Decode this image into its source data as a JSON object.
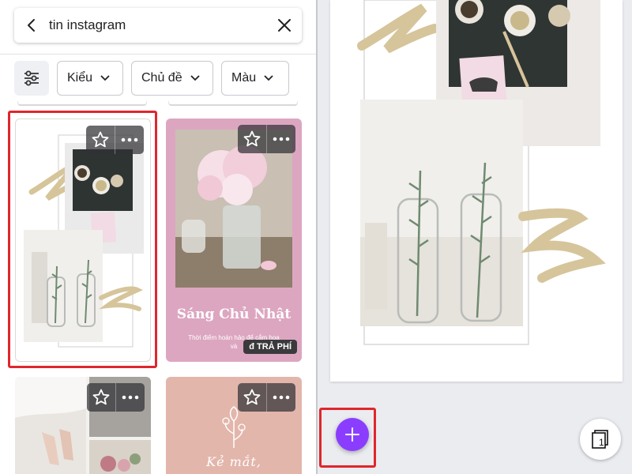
{
  "search": {
    "query": "tin instagram"
  },
  "filters": [
    {
      "label": "Kiểu"
    },
    {
      "label": "Chủ đề"
    },
    {
      "label": "Màu"
    }
  ],
  "templates": [
    {
      "selected": true
    },
    {
      "title": "Sáng Chủ Nhật",
      "subtitle": "Thời điểm hoàn hảo để cắm hoa và",
      "price_badge": "đ TRẢ PHÍ"
    },
    {},
    {
      "script_text": "Kẻ mắt,"
    }
  ],
  "editor": {
    "page_count": "1"
  },
  "colors": {
    "accent": "#8b3dff",
    "highlight": "#e0262c",
    "pink_template": "#dca6c1",
    "peach_template": "#e3b6ab"
  }
}
